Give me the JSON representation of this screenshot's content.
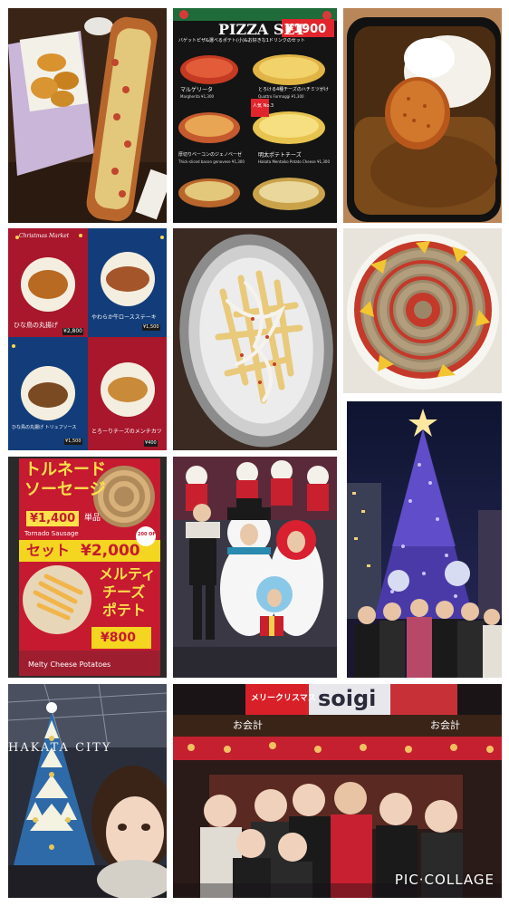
{
  "collage": {
    "watermark": "PIC·COLLAGE"
  },
  "tiles": {
    "pizza_set_menu": {
      "title": "PIZZA SET",
      "price": "¥1900",
      "subtitle": "バゲットピザ&選べるポテト(小)&お好きな1ドリンクのセット",
      "label_no3": "人気 No.3",
      "item1": "マルゲリータ",
      "item1_price": "Margherita ¥1,300",
      "item2": "とろける4種チーズのハチミツがけ",
      "item2_price": "Quattro Formaggi ¥1,300",
      "item3": "厚切りベーコンのジェノベーゼ",
      "item3_price": "Thick-sliced bacon genovese ¥1,300",
      "item4": "明太ポテトチーズ",
      "item4_price": "Hakata Mentaiko Potato Cheese ¥1,300"
    },
    "chicken_menu": {
      "logo": "Christmas Market",
      "item1": "ひな鳥の丸揚げ",
      "item1_price": "¥2,800",
      "item2": "やわらか牛ロースステーキ",
      "item2_price": "¥1,500",
      "item3": "ひな鳥の丸揚げ トリュフソース",
      "item3_price": "¥1,500",
      "item4": "とろーりチーズのメンチカツ",
      "item4_price": "¥400"
    },
    "tornado_poster": {
      "line1": "トルネード",
      "line2": "ソーセージ",
      "price1": "¥1,400",
      "tag": "単品",
      "set_label": "セット",
      "set_price": "¥2,000",
      "name_jp1": "メルティ",
      "name_jp2": "チーズ",
      "name_jp3": "ポテト",
      "potato_price": "¥800",
      "tornado_en": "Tornado Sausage",
      "potato_en": "Melty Cheese Potatoes",
      "off_badge": "200 OFF"
    },
    "hakata_city": {
      "sign": "HAKATA CITY"
    },
    "market_stall": {
      "top_sign": "メリークリスマス",
      "brand": "soigi",
      "checkout_left": "お会計",
      "checkout_right": "お会計"
    }
  }
}
